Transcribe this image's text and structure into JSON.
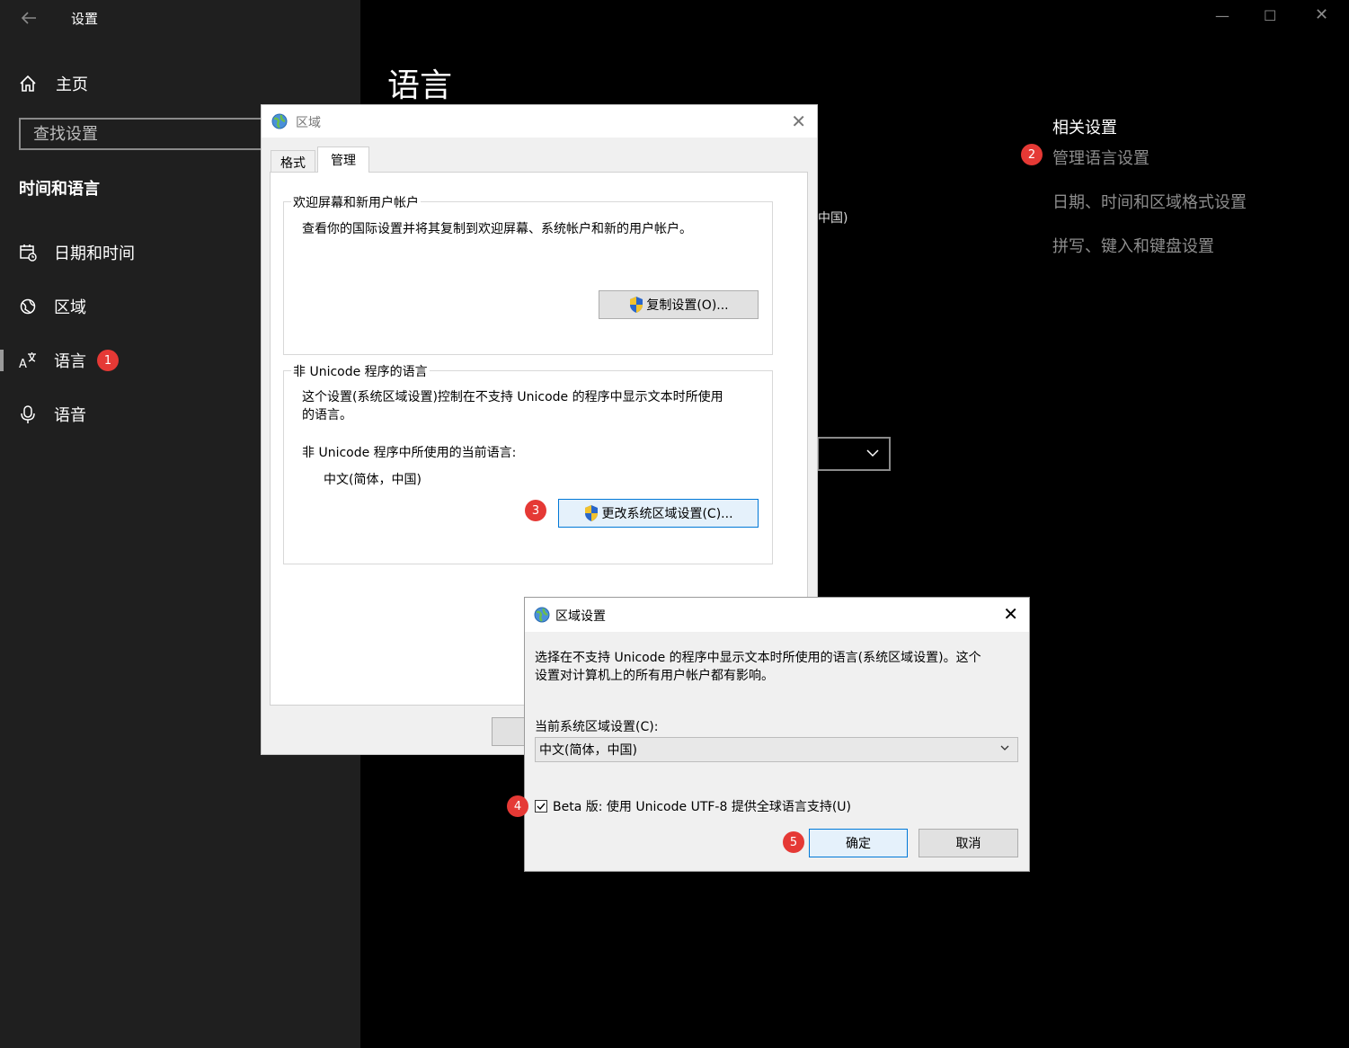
{
  "settings": {
    "app_title": "设置",
    "home_label": "主页",
    "search_placeholder": "查找设置",
    "section_title": "时间和语言",
    "nav": [
      {
        "label": "日期和时间"
      },
      {
        "label": "区域"
      },
      {
        "label": "语言",
        "badge": "1"
      },
      {
        "label": "语音"
      }
    ],
    "page_title": "语言",
    "related_title": "相关设置",
    "related_links": [
      {
        "label": "管理语言设置",
        "badge": "2"
      },
      {
        "label": "日期、时间和区域格式设置"
      },
      {
        "label": "拼写、键入和键盘设置"
      }
    ],
    "bg_fragment_text": "中国)"
  },
  "region_dialog": {
    "title": "区域",
    "tabs": [
      "格式",
      "管理"
    ],
    "welcome_group": {
      "legend": "欢迎屏幕和新用户帐户",
      "text": "查看你的国际设置并将其复制到欢迎屏幕、系统帐户和新的用户帐户。",
      "button": "复制设置(O)..."
    },
    "unicode_group": {
      "legend": "非 Unicode 程序的语言",
      "text_line1": "这个设置(系统区域设置)控制在不支持 Unicode 的程序中显示文本时所使用",
      "text_line2": "的语言。",
      "current_label": "非 Unicode 程序中所使用的当前语言:",
      "current_value": "中文(简体，中国)",
      "button": "更改系统区域设置(C)...",
      "badge": "3"
    }
  },
  "locale_dialog": {
    "title": "区域设置",
    "desc_line1": "选择在不支持 Unicode 的程序中显示文本时所使用的语言(系统区域设置)。这个",
    "desc_line2": "设置对计算机上的所有用户帐户都有影响。",
    "current_label": "当前系统区域设置(C):",
    "current_value": "中文(简体，中国)",
    "beta_checkbox": "Beta 版: 使用 Unicode UTF-8 提供全球语言支持(U)",
    "beta_checked": true,
    "beta_badge": "4",
    "ok_button": "确定",
    "ok_badge": "5",
    "cancel_button": "取消"
  }
}
